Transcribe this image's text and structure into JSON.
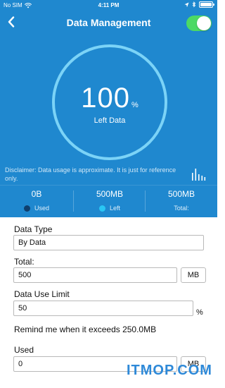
{
  "status_bar": {
    "carrier": "No SIM",
    "time": "4:11 PM"
  },
  "nav": {
    "title": "Data Management",
    "toggle_on": true
  },
  "ring": {
    "value": "100",
    "unit": "%",
    "label": "Left Data"
  },
  "disclaimer": "Disclaimer: Data usage is approximate. It is just for reference only.",
  "stats": [
    {
      "value": "0B",
      "label": "Used",
      "dot_color": "#0f3f6e"
    },
    {
      "value": "500MB",
      "label": "Left",
      "dot_color": "#29c6f4"
    },
    {
      "value": "500MB",
      "label": "Total:"
    }
  ],
  "form": {
    "data_type": {
      "label": "Data Type",
      "value": "By Data"
    },
    "total": {
      "label": "Total:",
      "value": "500",
      "unit": "MB"
    },
    "limit": {
      "label": "Data Use Limit",
      "value": "50",
      "unit": "%"
    },
    "remind_text": "Remind me when it exceeds 250.0MB",
    "used": {
      "label": "Used",
      "value": "0",
      "unit": "MB"
    }
  },
  "watermark": "ITMOP.COM",
  "colors": {
    "header_bg": "#1f88cf",
    "ring": "#7bd3f7",
    "toggle_on": "#4cd964"
  }
}
